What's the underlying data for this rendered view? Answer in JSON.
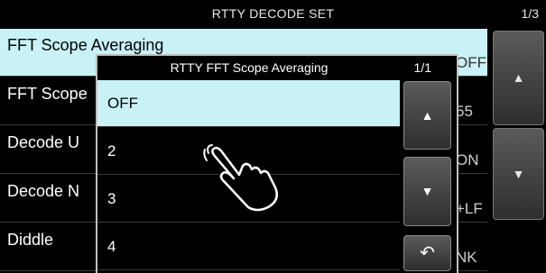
{
  "header": {
    "title": "RTTY DECODE SET",
    "page": "1/3"
  },
  "background_items": [
    {
      "label": "FFT Scope Averaging",
      "value": "OFF"
    },
    {
      "label": "FFT Scope",
      "value": "55"
    },
    {
      "label": "Decode U",
      "value": "ON"
    },
    {
      "label": "Decode N",
      "value": "+LF"
    },
    {
      "label": "Diddle",
      "value": "NK"
    }
  ],
  "scroll": {
    "up_icon": "triangle-up-icon",
    "down_icon": "triangle-down-icon"
  },
  "popup": {
    "title": "RTTY FFT Scope Averaging",
    "page": "1/1",
    "options": [
      "OFF",
      "2",
      "3",
      "4"
    ],
    "selected": "OFF",
    "back_icon": "return-arrow-icon"
  },
  "colors": {
    "highlight": "#c9f2f6",
    "background": "#000000",
    "text": "#ffffff"
  }
}
